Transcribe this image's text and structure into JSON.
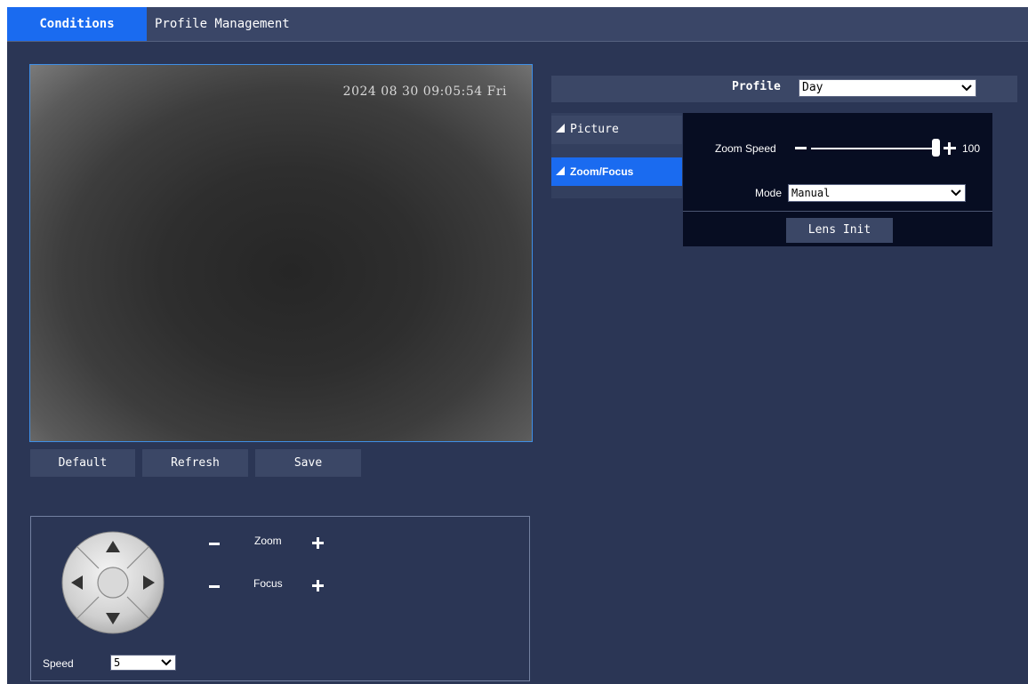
{
  "tabs": [
    {
      "label": "Conditions",
      "active": true
    },
    {
      "label": "Profile Management",
      "active": false
    }
  ],
  "video": {
    "osd_timestamp": "2024 08 30 09:05:54 Fri"
  },
  "actions": {
    "default_label": "Default",
    "refresh_label": "Refresh",
    "save_label": "Save"
  },
  "ptz": {
    "zoom_label": "Zoom",
    "focus_label": "Focus",
    "speed_label": "Speed",
    "speed_value": "5"
  },
  "profile": {
    "label": "Profile",
    "value": "Day"
  },
  "subnav": [
    {
      "label": "Picture",
      "active": false
    },
    {
      "label": "Zoom/Focus",
      "active": true
    }
  ],
  "zoomfocus": {
    "zoom_speed_label": "Zoom Speed",
    "zoom_speed_value": "100",
    "zoom_speed_fraction": 1.0,
    "mode_label": "Mode",
    "mode_value": "Manual",
    "lens_init_label": "Lens Init"
  },
  "colors": {
    "accent": "#1a6bf0",
    "background": "#2b3655",
    "panel": "#070d22"
  }
}
